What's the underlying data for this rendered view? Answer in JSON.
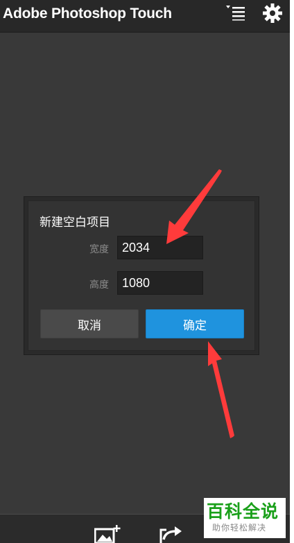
{
  "app": {
    "title": "Adobe Photoshop Touch"
  },
  "dialog": {
    "title": "新建空白项目",
    "width_label": "宽度",
    "width_value": "2034",
    "height_label": "高度",
    "height_value": "1080",
    "cancel_label": "取消",
    "ok_label": "确定"
  },
  "watermark": {
    "top": "百科全说",
    "bottom": "助你轻松解决"
  },
  "colors": {
    "accent": "#1f93de",
    "annotation": "#ff3b3b",
    "watermark": "#1aa01a"
  },
  "icons": [
    "menu-icon",
    "gear-icon",
    "add-image-icon",
    "share-icon"
  ]
}
